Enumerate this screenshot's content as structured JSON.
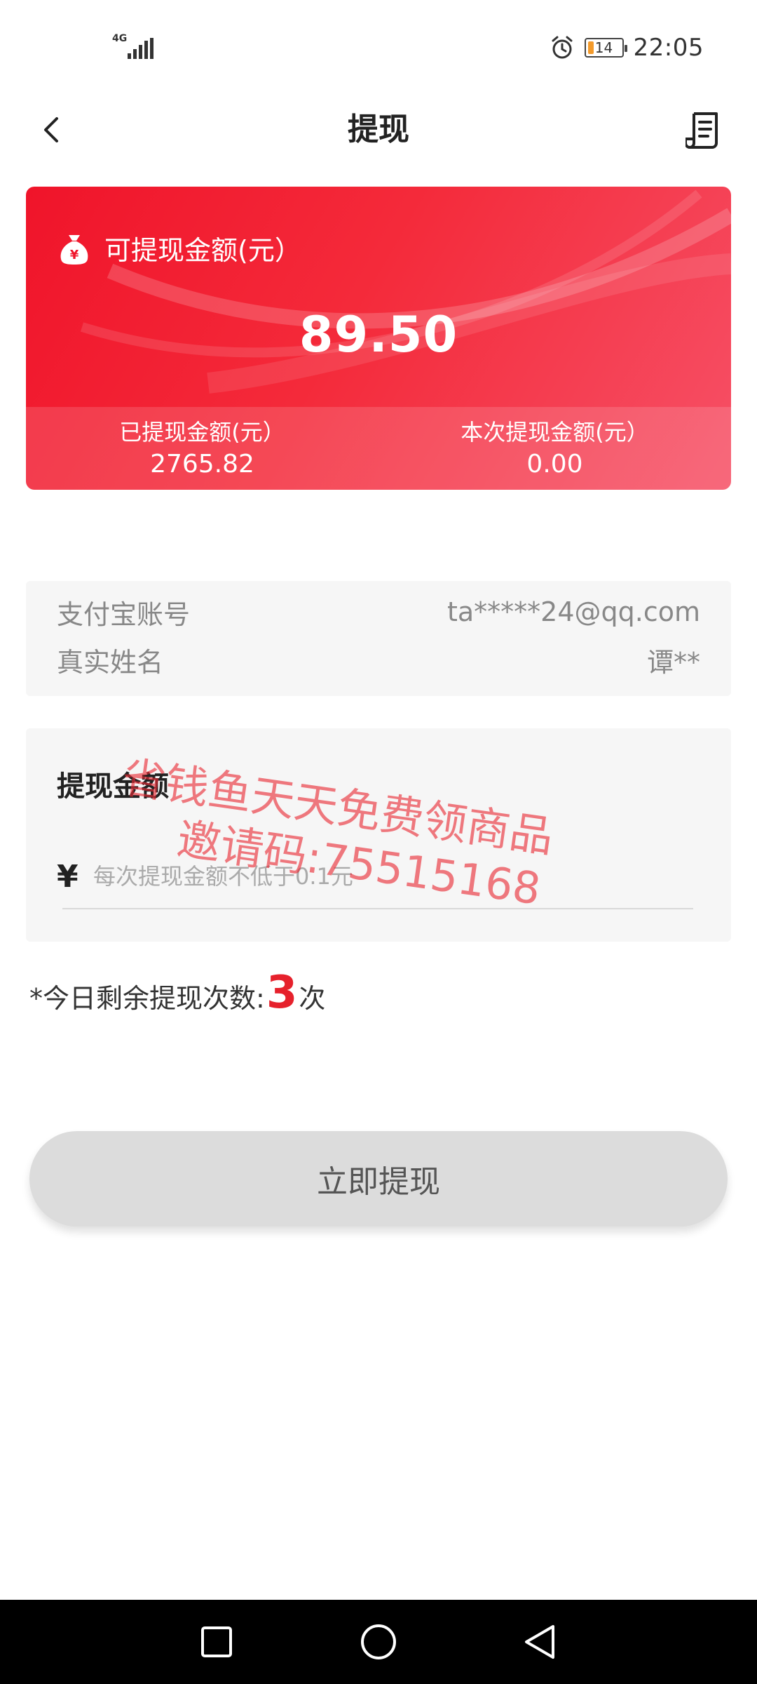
{
  "status_bar": {
    "network": "4G",
    "battery_level": "14",
    "time": "22:05",
    "icons": [
      "signal-icon",
      "alarm-icon",
      "battery-icon"
    ]
  },
  "header": {
    "title": "提现",
    "back_icon": "chevron-left-icon",
    "records_icon": "receipt-icon"
  },
  "balance_card": {
    "label": "可提现金额(元）",
    "amount": "89.50",
    "withdrawn_label": "已提现金额(元）",
    "withdrawn_value": "2765.82",
    "current_label": "本次提现金额(元）",
    "current_value": "0.00",
    "icon": "money-bag-icon",
    "colors": {
      "start": "#f0142a",
      "end": "#f65066"
    }
  },
  "account": {
    "alipay_label": "支付宝账号",
    "alipay_value": "ta*****24@qq.com",
    "name_label": "真实姓名",
    "name_value": "谭**"
  },
  "amount_section": {
    "title": "提现金额",
    "currency": "¥",
    "placeholder": "每次提现金额不低于0.1元",
    "value": ""
  },
  "watermark": {
    "line1": "省钱鱼天天免费领商品",
    "line2": "邀请码:75515168"
  },
  "remaining": {
    "prefix": "*今日剩余提现次数:",
    "count": "3",
    "suffix": "次"
  },
  "submit": {
    "label": "立即提现"
  },
  "nav_bar": {
    "icons": [
      "square-icon",
      "circle-icon",
      "triangle-back-icon"
    ]
  }
}
